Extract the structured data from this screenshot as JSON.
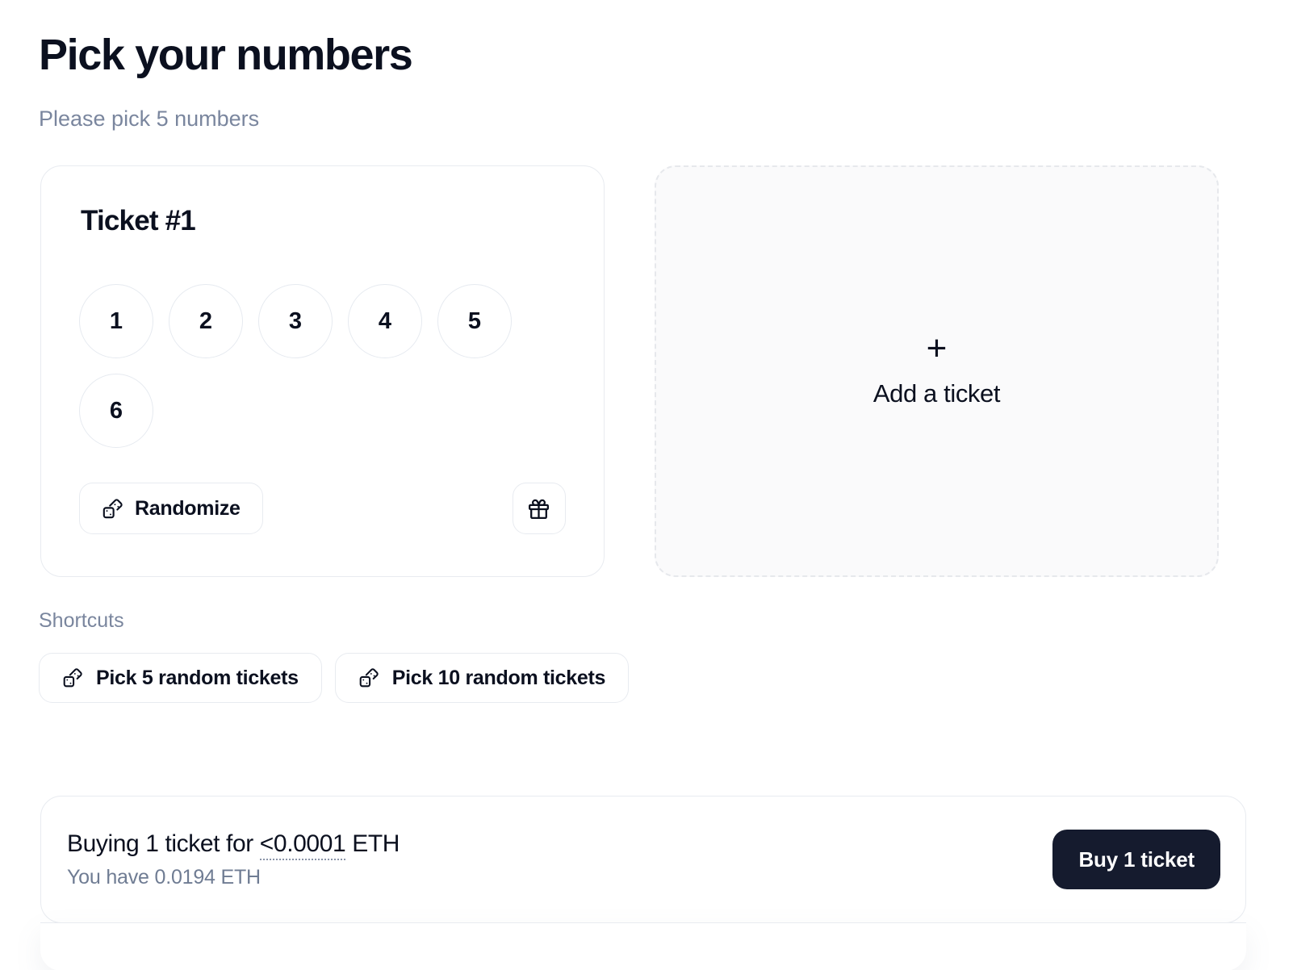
{
  "header": {
    "title": "Pick your numbers",
    "subtitle": "Please pick 5 numbers"
  },
  "tickets": [
    {
      "title": "Ticket #1",
      "numbers": [
        "1",
        "2",
        "3",
        "4",
        "5",
        "6"
      ],
      "randomize_label": "Randomize",
      "randomize_icon": "dices-icon",
      "gift_icon": "gift-icon"
    }
  ],
  "add_ticket": {
    "plus": "+",
    "label": "Add a ticket",
    "plus_icon": "plus-icon"
  },
  "shortcuts": {
    "label": "Shortcuts",
    "buttons": [
      {
        "label": "Pick 5 random tickets",
        "icon": "dices-icon"
      },
      {
        "label": "Pick 10 random tickets",
        "icon": "dices-icon"
      }
    ]
  },
  "purchase": {
    "summary_prefix": "Buying 1 ticket for ",
    "price": "<0.0001",
    "summary_suffix": " ETH",
    "balance": "You have 0.0194 ETH",
    "buy_label": "Buy 1 ticket"
  },
  "colors": {
    "text_primary": "#0B101F",
    "text_muted": "#7A869E",
    "border": "#E8EBF0",
    "accent_dark": "#151B2E",
    "dashed_fill": "#FAFAFB"
  }
}
